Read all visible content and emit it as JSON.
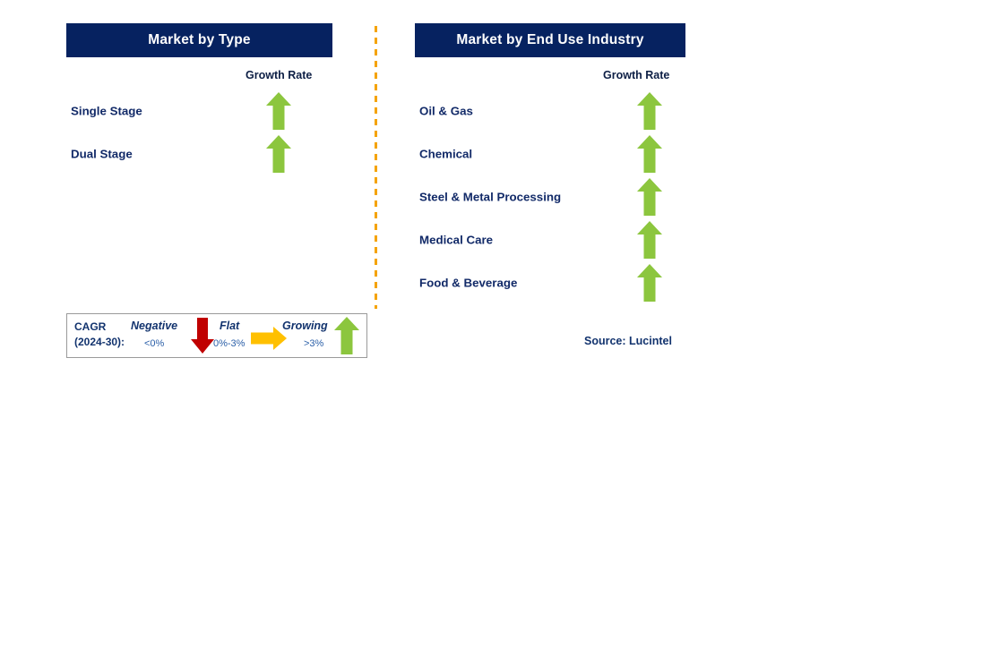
{
  "panels": [
    {
      "id": "market-by-type",
      "title": "Market by Type",
      "growth_caption": "Growth Rate",
      "rows": [
        {
          "label": "Single Stage",
          "growth": "growing",
          "arrow": "arrow-up-icon"
        },
        {
          "label": "Dual Stage",
          "growth": "growing",
          "arrow": "arrow-up-icon"
        }
      ]
    },
    {
      "id": "market-by-end-use-industry",
      "title": "Market by End Use Industry",
      "growth_caption": "Growth Rate",
      "rows": [
        {
          "label": "Oil & Gas",
          "growth": "growing",
          "arrow": "arrow-up-icon"
        },
        {
          "label": "Chemical",
          "growth": "growing",
          "arrow": "arrow-up-icon"
        },
        {
          "label": "Steel & Metal Processing",
          "growth": "growing",
          "arrow": "arrow-up-icon"
        },
        {
          "label": "Medical Care",
          "growth": "growing",
          "arrow": "arrow-up-icon"
        },
        {
          "label": "Food & Beverage",
          "growth": "growing",
          "arrow": "arrow-up-icon"
        }
      ]
    }
  ],
  "legend": {
    "title_line1": "CAGR",
    "title_line2": "(2024-30):",
    "entries": [
      {
        "term": "Negative",
        "range": "<0%",
        "icon": "arrow-down-icon",
        "color": "#c00000"
      },
      {
        "term": "Flat",
        "range": "0%-3%",
        "icon": "arrow-right-icon",
        "color": "#ffc000"
      },
      {
        "term": "Growing",
        "range": ">3%",
        "icon": "arrow-up-icon",
        "color": "#8cc63e"
      }
    ]
  },
  "source": "Source: Lucintel",
  "colors": {
    "header_bg": "#062260",
    "header_text": "#ffffff",
    "label_text": "#122a68",
    "growing": "#8cc63e",
    "flat": "#ffc000",
    "negative": "#c00000",
    "divider": "#f5a300"
  }
}
